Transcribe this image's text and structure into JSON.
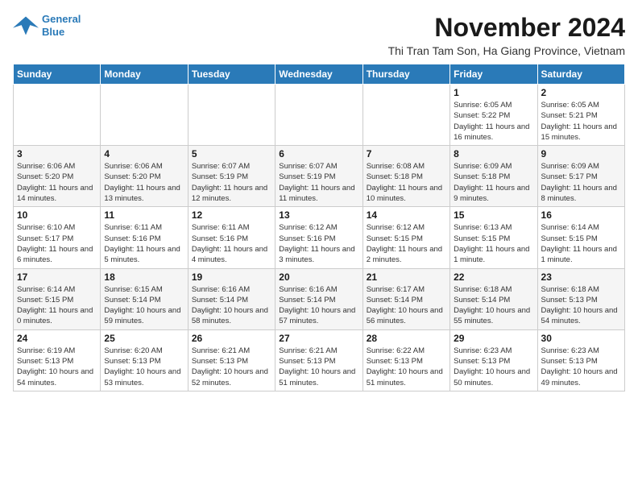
{
  "logo": {
    "name_line1": "General",
    "name_line2": "Blue"
  },
  "header": {
    "month_title": "November 2024",
    "subtitle": "Thi Tran Tam Son, Ha Giang Province, Vietnam"
  },
  "days_of_week": [
    "Sunday",
    "Monday",
    "Tuesday",
    "Wednesday",
    "Thursday",
    "Friday",
    "Saturday"
  ],
  "weeks": [
    [
      {
        "day": "",
        "info": ""
      },
      {
        "day": "",
        "info": ""
      },
      {
        "day": "",
        "info": ""
      },
      {
        "day": "",
        "info": ""
      },
      {
        "day": "",
        "info": ""
      },
      {
        "day": "1",
        "info": "Sunrise: 6:05 AM\nSunset: 5:22 PM\nDaylight: 11 hours and 16 minutes."
      },
      {
        "day": "2",
        "info": "Sunrise: 6:05 AM\nSunset: 5:21 PM\nDaylight: 11 hours and 15 minutes."
      }
    ],
    [
      {
        "day": "3",
        "info": "Sunrise: 6:06 AM\nSunset: 5:20 PM\nDaylight: 11 hours and 14 minutes."
      },
      {
        "day": "4",
        "info": "Sunrise: 6:06 AM\nSunset: 5:20 PM\nDaylight: 11 hours and 13 minutes."
      },
      {
        "day": "5",
        "info": "Sunrise: 6:07 AM\nSunset: 5:19 PM\nDaylight: 11 hours and 12 minutes."
      },
      {
        "day": "6",
        "info": "Sunrise: 6:07 AM\nSunset: 5:19 PM\nDaylight: 11 hours and 11 minutes."
      },
      {
        "day": "7",
        "info": "Sunrise: 6:08 AM\nSunset: 5:18 PM\nDaylight: 11 hours and 10 minutes."
      },
      {
        "day": "8",
        "info": "Sunrise: 6:09 AM\nSunset: 5:18 PM\nDaylight: 11 hours and 9 minutes."
      },
      {
        "day": "9",
        "info": "Sunrise: 6:09 AM\nSunset: 5:17 PM\nDaylight: 11 hours and 8 minutes."
      }
    ],
    [
      {
        "day": "10",
        "info": "Sunrise: 6:10 AM\nSunset: 5:17 PM\nDaylight: 11 hours and 6 minutes."
      },
      {
        "day": "11",
        "info": "Sunrise: 6:11 AM\nSunset: 5:16 PM\nDaylight: 11 hours and 5 minutes."
      },
      {
        "day": "12",
        "info": "Sunrise: 6:11 AM\nSunset: 5:16 PM\nDaylight: 11 hours and 4 minutes."
      },
      {
        "day": "13",
        "info": "Sunrise: 6:12 AM\nSunset: 5:16 PM\nDaylight: 11 hours and 3 minutes."
      },
      {
        "day": "14",
        "info": "Sunrise: 6:12 AM\nSunset: 5:15 PM\nDaylight: 11 hours and 2 minutes."
      },
      {
        "day": "15",
        "info": "Sunrise: 6:13 AM\nSunset: 5:15 PM\nDaylight: 11 hours and 1 minute."
      },
      {
        "day": "16",
        "info": "Sunrise: 6:14 AM\nSunset: 5:15 PM\nDaylight: 11 hours and 1 minute."
      }
    ],
    [
      {
        "day": "17",
        "info": "Sunrise: 6:14 AM\nSunset: 5:15 PM\nDaylight: 11 hours and 0 minutes."
      },
      {
        "day": "18",
        "info": "Sunrise: 6:15 AM\nSunset: 5:14 PM\nDaylight: 10 hours and 59 minutes."
      },
      {
        "day": "19",
        "info": "Sunrise: 6:16 AM\nSunset: 5:14 PM\nDaylight: 10 hours and 58 minutes."
      },
      {
        "day": "20",
        "info": "Sunrise: 6:16 AM\nSunset: 5:14 PM\nDaylight: 10 hours and 57 minutes."
      },
      {
        "day": "21",
        "info": "Sunrise: 6:17 AM\nSunset: 5:14 PM\nDaylight: 10 hours and 56 minutes."
      },
      {
        "day": "22",
        "info": "Sunrise: 6:18 AM\nSunset: 5:14 PM\nDaylight: 10 hours and 55 minutes."
      },
      {
        "day": "23",
        "info": "Sunrise: 6:18 AM\nSunset: 5:13 PM\nDaylight: 10 hours and 54 minutes."
      }
    ],
    [
      {
        "day": "24",
        "info": "Sunrise: 6:19 AM\nSunset: 5:13 PM\nDaylight: 10 hours and 54 minutes."
      },
      {
        "day": "25",
        "info": "Sunrise: 6:20 AM\nSunset: 5:13 PM\nDaylight: 10 hours and 53 minutes."
      },
      {
        "day": "26",
        "info": "Sunrise: 6:21 AM\nSunset: 5:13 PM\nDaylight: 10 hours and 52 minutes."
      },
      {
        "day": "27",
        "info": "Sunrise: 6:21 AM\nSunset: 5:13 PM\nDaylight: 10 hours and 51 minutes."
      },
      {
        "day": "28",
        "info": "Sunrise: 6:22 AM\nSunset: 5:13 PM\nDaylight: 10 hours and 51 minutes."
      },
      {
        "day": "29",
        "info": "Sunrise: 6:23 AM\nSunset: 5:13 PM\nDaylight: 10 hours and 50 minutes."
      },
      {
        "day": "30",
        "info": "Sunrise: 6:23 AM\nSunset: 5:13 PM\nDaylight: 10 hours and 49 minutes."
      }
    ]
  ]
}
